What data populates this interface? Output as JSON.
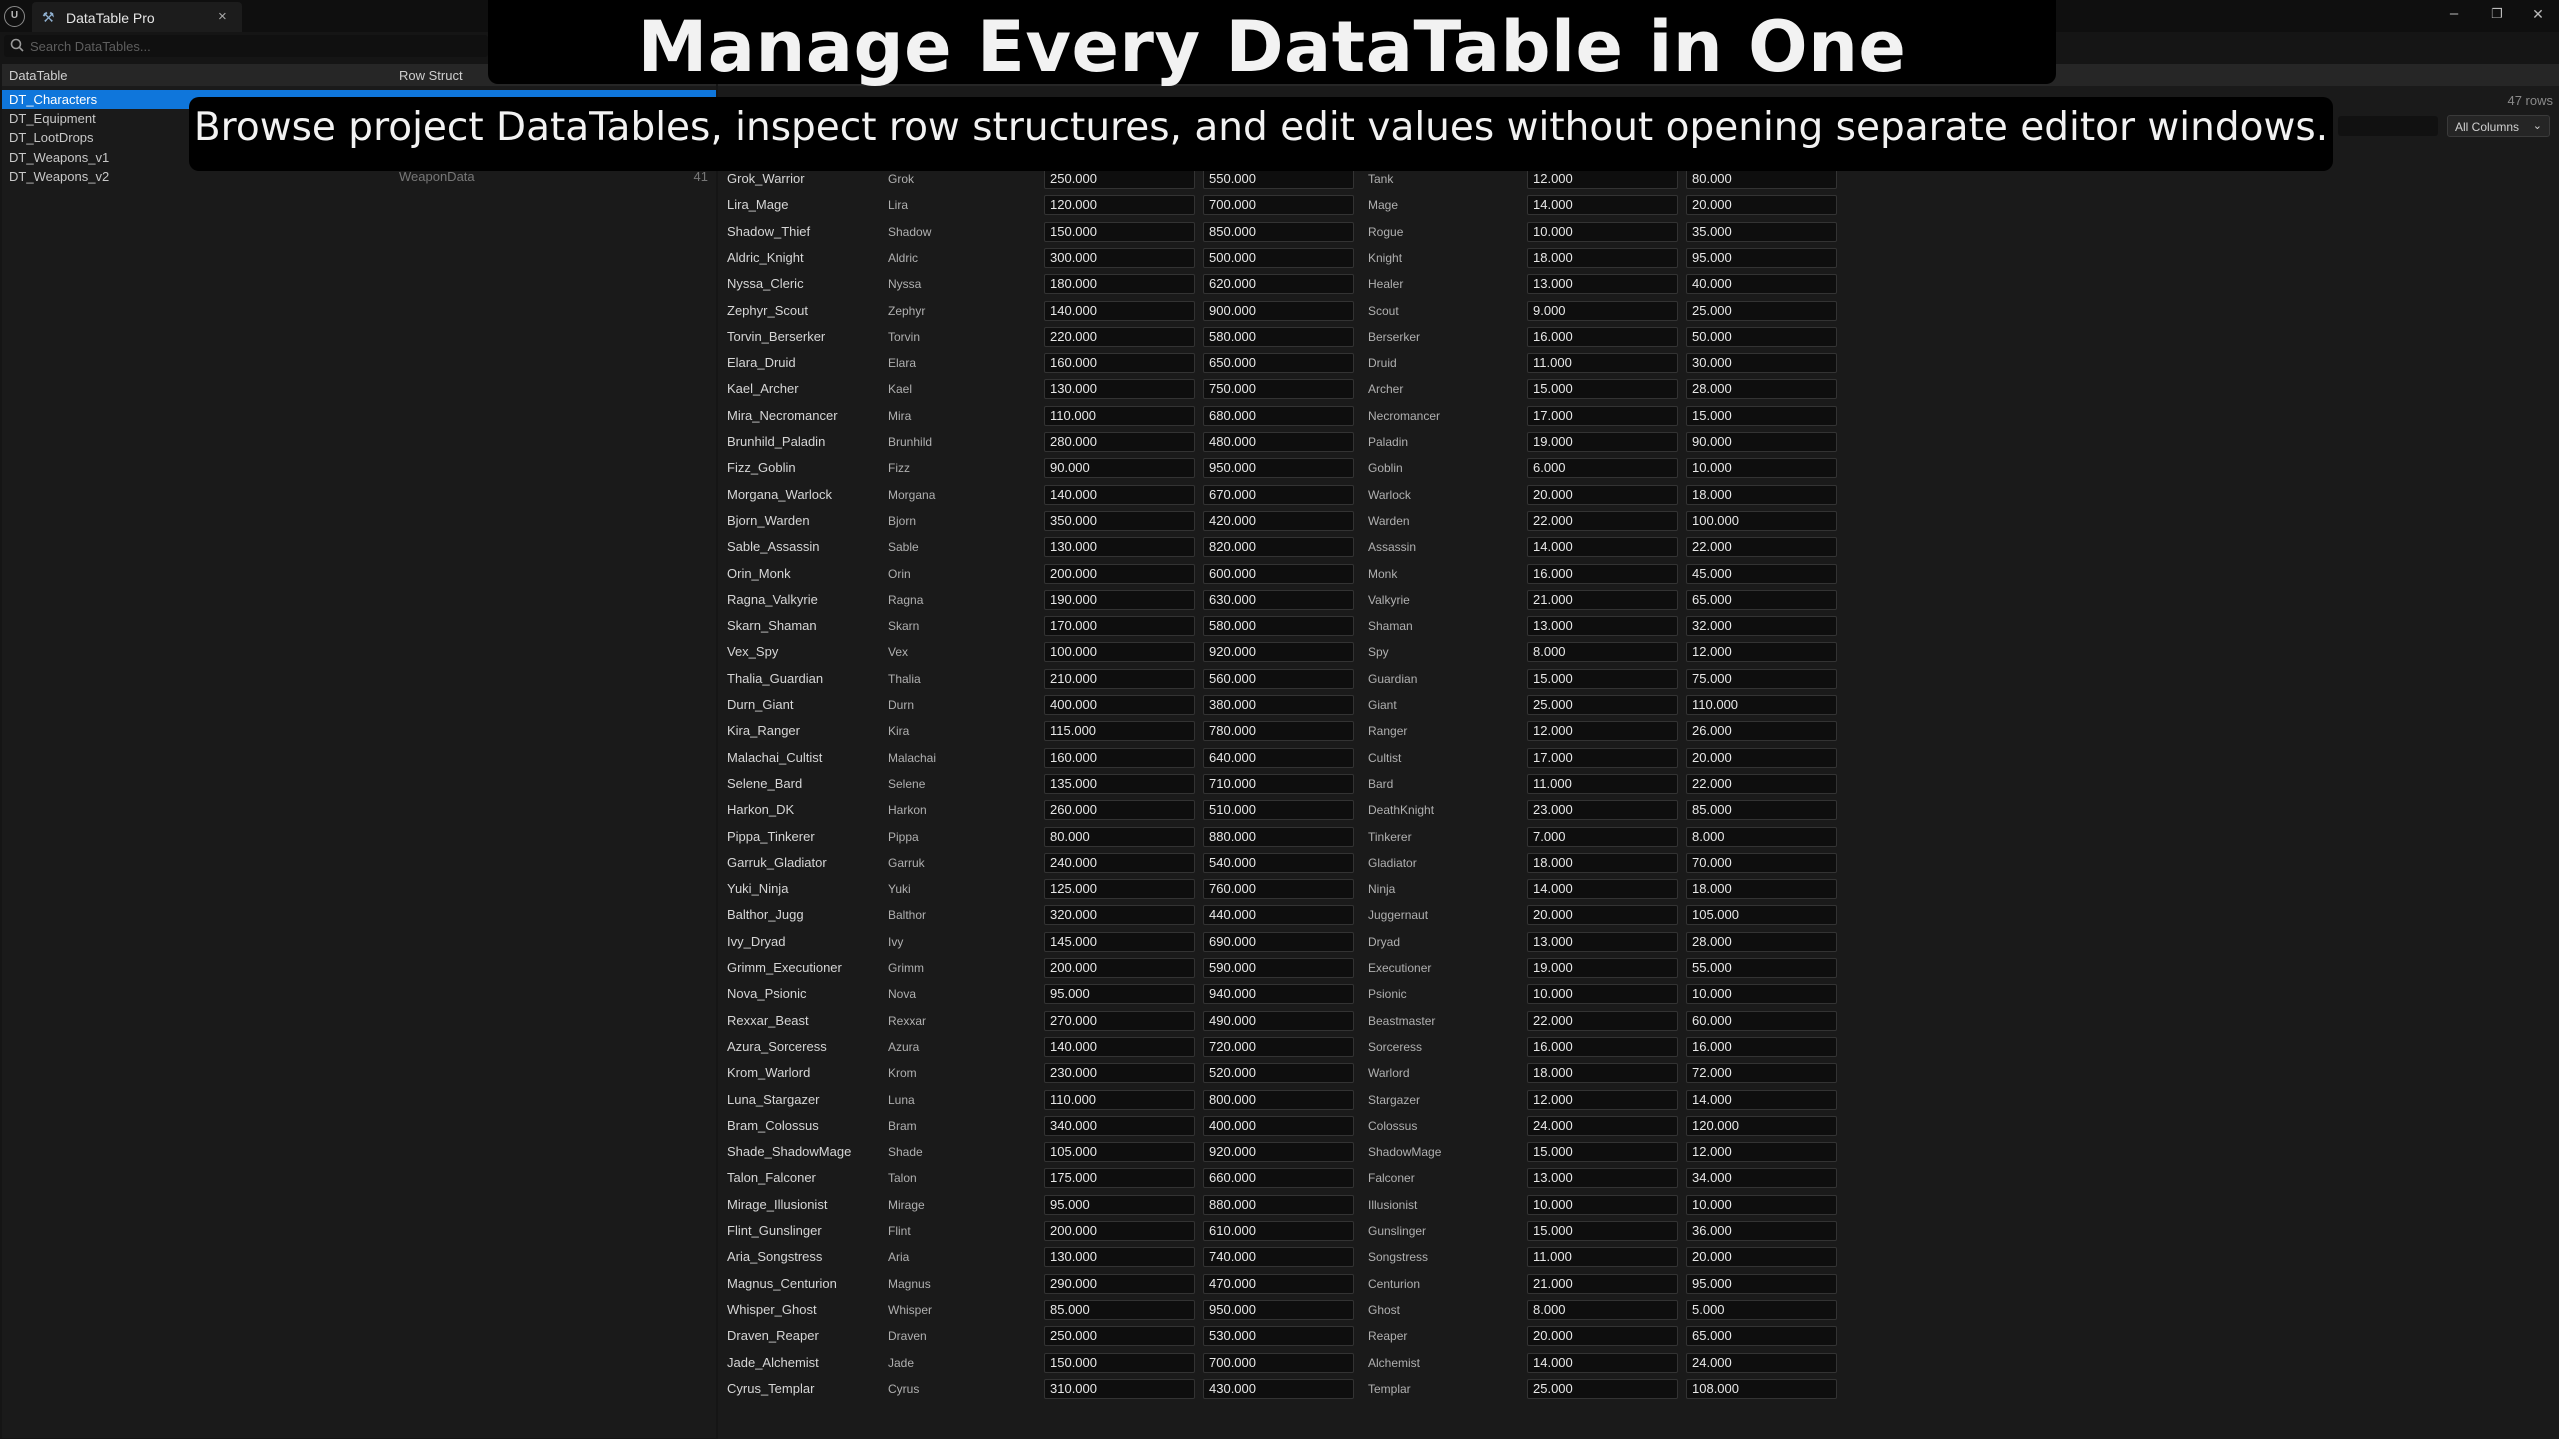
{
  "window": {
    "tab_title": "DataTable Pro",
    "tab_close": "×",
    "min": "–",
    "restore": "❐",
    "close": "✕"
  },
  "search": {
    "placeholder": "Search DataTables..."
  },
  "left_panel": {
    "headers": {
      "datatable": "DataTable",
      "row_struct": "Row Struct"
    },
    "tables": [
      {
        "name": "DT_Characters",
        "struct": "",
        "count": "",
        "selected": true
      },
      {
        "name": "DT_Equipment",
        "struct": "",
        "count": ""
      },
      {
        "name": "DT_LootDrops",
        "struct": "",
        "count": ""
      },
      {
        "name": "DT_Weapons_v1",
        "struct": "",
        "count": ""
      },
      {
        "name": "DT_Weapons_v2",
        "struct": "WeaponData",
        "count": "41"
      }
    ]
  },
  "right_panel": {
    "rows_count": "47 rows",
    "column_filter": "All Columns"
  },
  "overlay": {
    "title": "Manage Every DataTable in One Workspace",
    "subtitle": "Browse project DataTables, inspect row structures, and edit values without opening separate editor windows."
  },
  "rows": [
    [
      "Grok_Warrior",
      "Grok",
      "250.000",
      "550.000",
      "Tank",
      "12.000",
      "80.000"
    ],
    [
      "Lira_Mage",
      "Lira",
      "120.000",
      "700.000",
      "Mage",
      "14.000",
      "20.000"
    ],
    [
      "Shadow_Thief",
      "Shadow",
      "150.000",
      "850.000",
      "Rogue",
      "10.000",
      "35.000"
    ],
    [
      "Aldric_Knight",
      "Aldric",
      "300.000",
      "500.000",
      "Knight",
      "18.000",
      "95.000"
    ],
    [
      "Nyssa_Cleric",
      "Nyssa",
      "180.000",
      "620.000",
      "Healer",
      "13.000",
      "40.000"
    ],
    [
      "Zephyr_Scout",
      "Zephyr",
      "140.000",
      "900.000",
      "Scout",
      "9.000",
      "25.000"
    ],
    [
      "Torvin_Berserker",
      "Torvin",
      "220.000",
      "580.000",
      "Berserker",
      "16.000",
      "50.000"
    ],
    [
      "Elara_Druid",
      "Elara",
      "160.000",
      "650.000",
      "Druid",
      "11.000",
      "30.000"
    ],
    [
      "Kael_Archer",
      "Kael",
      "130.000",
      "750.000",
      "Archer",
      "15.000",
      "28.000"
    ],
    [
      "Mira_Necromancer",
      "Mira",
      "110.000",
      "680.000",
      "Necromancer",
      "17.000",
      "15.000"
    ],
    [
      "Brunhild_Paladin",
      "Brunhild",
      "280.000",
      "480.000",
      "Paladin",
      "19.000",
      "90.000"
    ],
    [
      "Fizz_Goblin",
      "Fizz",
      "90.000",
      "950.000",
      "Goblin",
      "6.000",
      "10.000"
    ],
    [
      "Morgana_Warlock",
      "Morgana",
      "140.000",
      "670.000",
      "Warlock",
      "20.000",
      "18.000"
    ],
    [
      "Bjorn_Warden",
      "Bjorn",
      "350.000",
      "420.000",
      "Warden",
      "22.000",
      "100.000"
    ],
    [
      "Sable_Assassin",
      "Sable",
      "130.000",
      "820.000",
      "Assassin",
      "14.000",
      "22.000"
    ],
    [
      "Orin_Monk",
      "Orin",
      "200.000",
      "600.000",
      "Monk",
      "16.000",
      "45.000"
    ],
    [
      "Ragna_Valkyrie",
      "Ragna",
      "190.000",
      "630.000",
      "Valkyrie",
      "21.000",
      "65.000"
    ],
    [
      "Skarn_Shaman",
      "Skarn",
      "170.000",
      "580.000",
      "Shaman",
      "13.000",
      "32.000"
    ],
    [
      "Vex_Spy",
      "Vex",
      "100.000",
      "920.000",
      "Spy",
      "8.000",
      "12.000"
    ],
    [
      "Thalia_Guardian",
      "Thalia",
      "210.000",
      "560.000",
      "Guardian",
      "15.000",
      "75.000"
    ],
    [
      "Durn_Giant",
      "Durn",
      "400.000",
      "380.000",
      "Giant",
      "25.000",
      "110.000"
    ],
    [
      "Kira_Ranger",
      "Kira",
      "115.000",
      "780.000",
      "Ranger",
      "12.000",
      "26.000"
    ],
    [
      "Malachai_Cultist",
      "Malachai",
      "160.000",
      "640.000",
      "Cultist",
      "17.000",
      "20.000"
    ],
    [
      "Selene_Bard",
      "Selene",
      "135.000",
      "710.000",
      "Bard",
      "11.000",
      "22.000"
    ],
    [
      "Harkon_DK",
      "Harkon",
      "260.000",
      "510.000",
      "DeathKnight",
      "23.000",
      "85.000"
    ],
    [
      "Pippa_Tinkerer",
      "Pippa",
      "80.000",
      "880.000",
      "Tinkerer",
      "7.000",
      "8.000"
    ],
    [
      "Garruk_Gladiator",
      "Garruk",
      "240.000",
      "540.000",
      "Gladiator",
      "18.000",
      "70.000"
    ],
    [
      "Yuki_Ninja",
      "Yuki",
      "125.000",
      "760.000",
      "Ninja",
      "14.000",
      "18.000"
    ],
    [
      "Balthor_Jugg",
      "Balthor",
      "320.000",
      "440.000",
      "Juggernaut",
      "20.000",
      "105.000"
    ],
    [
      "Ivy_Dryad",
      "Ivy",
      "145.000",
      "690.000",
      "Dryad",
      "13.000",
      "28.000"
    ],
    [
      "Grimm_Executioner",
      "Grimm",
      "200.000",
      "590.000",
      "Executioner",
      "19.000",
      "55.000"
    ],
    [
      "Nova_Psionic",
      "Nova",
      "95.000",
      "940.000",
      "Psionic",
      "10.000",
      "10.000"
    ],
    [
      "Rexxar_Beast",
      "Rexxar",
      "270.000",
      "490.000",
      "Beastmaster",
      "22.000",
      "60.000"
    ],
    [
      "Azura_Sorceress",
      "Azura",
      "140.000",
      "720.000",
      "Sorceress",
      "16.000",
      "16.000"
    ],
    [
      "Krom_Warlord",
      "Krom",
      "230.000",
      "520.000",
      "Warlord",
      "18.000",
      "72.000"
    ],
    [
      "Luna_Stargazer",
      "Luna",
      "110.000",
      "800.000",
      "Stargazer",
      "12.000",
      "14.000"
    ],
    [
      "Bram_Colossus",
      "Bram",
      "340.000",
      "400.000",
      "Colossus",
      "24.000",
      "120.000"
    ],
    [
      "Shade_ShadowMage",
      "Shade",
      "105.000",
      "920.000",
      "ShadowMage",
      "15.000",
      "12.000"
    ],
    [
      "Talon_Falconer",
      "Talon",
      "175.000",
      "660.000",
      "Falconer",
      "13.000",
      "34.000"
    ],
    [
      "Mirage_Illusionist",
      "Mirage",
      "95.000",
      "880.000",
      "Illusionist",
      "10.000",
      "10.000"
    ],
    [
      "Flint_Gunslinger",
      "Flint",
      "200.000",
      "610.000",
      "Gunslinger",
      "15.000",
      "36.000"
    ],
    [
      "Aria_Songstress",
      "Aria",
      "130.000",
      "740.000",
      "Songstress",
      "11.000",
      "20.000"
    ],
    [
      "Magnus_Centurion",
      "Magnus",
      "290.000",
      "470.000",
      "Centurion",
      "21.000",
      "95.000"
    ],
    [
      "Whisper_Ghost",
      "Whisper",
      "85.000",
      "950.000",
      "Ghost",
      "8.000",
      "5.000"
    ],
    [
      "Draven_Reaper",
      "Draven",
      "250.000",
      "530.000",
      "Reaper",
      "20.000",
      "65.000"
    ],
    [
      "Jade_Alchemist",
      "Jade",
      "150.000",
      "700.000",
      "Alchemist",
      "14.000",
      "24.000"
    ],
    [
      "Cyrus_Templar",
      "Cyrus",
      "310.000",
      "430.000",
      "Templar",
      "25.000",
      "108.000"
    ]
  ]
}
